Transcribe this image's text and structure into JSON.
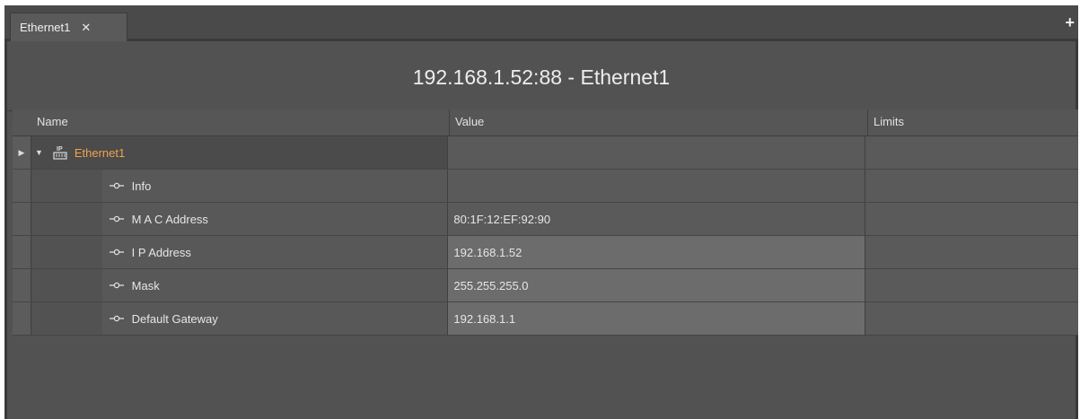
{
  "tabs": [
    {
      "label": "Ethernet1",
      "close_glyph": "✕",
      "active": true
    }
  ],
  "add_tab_glyph": "+",
  "page": {
    "title": "192.168.1.52:88 - Ethernet1"
  },
  "grid": {
    "columns": [
      "Name",
      "Value",
      "Limits"
    ],
    "root": {
      "label": "Ethernet1",
      "icon": "ethernet-port-icon",
      "expanded": true,
      "label_color": "#f0a24c"
    },
    "rows": [
      {
        "name": "Info",
        "value": "",
        "limits": "",
        "editable": false,
        "icon": "property-pin-icon"
      },
      {
        "name": "M A C Address",
        "value": "80:1F:12:EF:92:90",
        "limits": "",
        "editable": false,
        "icon": "property-pin-icon"
      },
      {
        "name": "I P Address",
        "value": "192.168.1.52",
        "limits": "",
        "editable": true,
        "icon": "property-pin-icon"
      },
      {
        "name": "Mask",
        "value": "255.255.255.0",
        "limits": "",
        "editable": true,
        "icon": "property-pin-icon"
      },
      {
        "name": "Default Gateway",
        "value": "192.168.1.1",
        "limits": "",
        "editable": true,
        "icon": "property-pin-icon"
      }
    ]
  },
  "colors": {
    "background": "#535353",
    "accent_orange": "#f0a24c",
    "editable_cell": "#6c6c6c"
  }
}
